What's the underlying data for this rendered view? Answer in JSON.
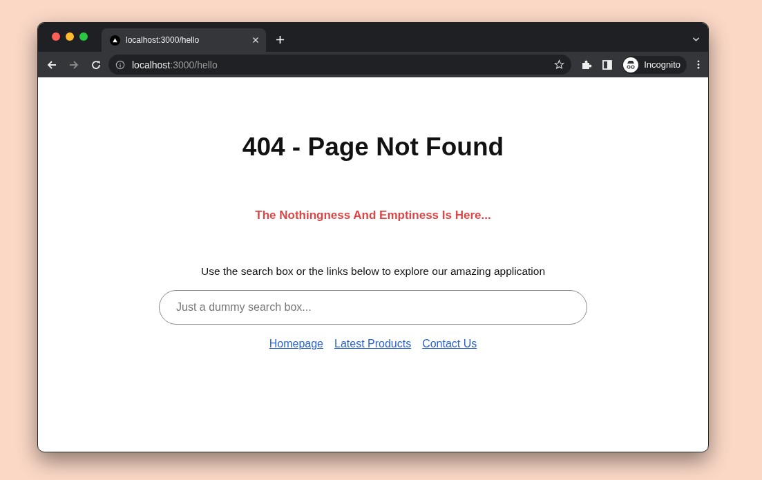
{
  "browser": {
    "tabs": [
      {
        "title": "localhost:3000/hello",
        "selected": true
      }
    ],
    "address": {
      "host": "localhost",
      "path": ":3000/hello"
    },
    "profile": {
      "label": "Incognito"
    }
  },
  "page": {
    "title": "404 - Page Not Found",
    "subtitle": "The Nothingness And Emptiness Is Here...",
    "description": "Use the search box or the links below to explore our amazing application",
    "search": {
      "placeholder": "Just a dummy search box..."
    },
    "links": [
      {
        "label": "Homepage"
      },
      {
        "label": "Latest Products"
      },
      {
        "label": "Contact Us"
      }
    ]
  }
}
